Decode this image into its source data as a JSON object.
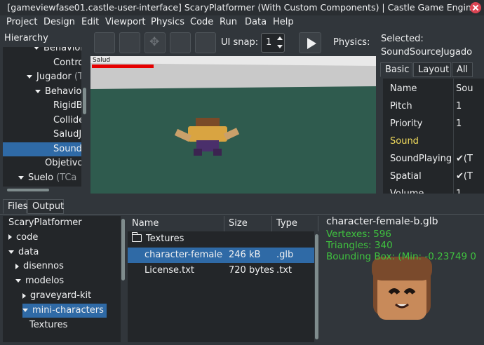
{
  "window": {
    "title": "[gameviewfase01.castle-user-interface] ScaryPlatformer (With Custom Components) | Castle Game Engine"
  },
  "menu": [
    "Project",
    "Design",
    "Edit",
    "Viewport",
    "Physics",
    "Code",
    "Run",
    "Data",
    "Help"
  ],
  "hierarchy": {
    "label": "Hierarchy",
    "items": [
      {
        "text": "Behavior",
        "suffix": "",
        "expanded": true
      },
      {
        "text": "Control",
        "suffix": "",
        "expanded": null
      },
      {
        "text": "Jugador",
        "suffix": "(T",
        "expanded": true
      },
      {
        "text": "Behavior",
        "suffix": "",
        "expanded": true
      },
      {
        "text": "RigidBc",
        "suffix": "",
        "expanded": null
      },
      {
        "text": "Collider",
        "suffix": "",
        "expanded": null
      },
      {
        "text": "SaludJu",
        "suffix": "",
        "expanded": null
      },
      {
        "text": "SoundS",
        "suffix": "",
        "expanded": null,
        "selected": true
      },
      {
        "text": "Objetivo",
        "suffix": "",
        "expanded": null
      },
      {
        "text": "Suelo",
        "suffix": "(TCa",
        "expanded": true
      }
    ]
  },
  "toolbar": {
    "ui_snap_label": "UI snap:",
    "ui_snap_value": "1",
    "physics_label": "Physics:"
  },
  "viewport": {
    "health_label": "Salud",
    "health_fraction": 0.7
  },
  "inspector": {
    "selected_label": "Selected:",
    "selected_name": "SoundSourceJugado",
    "tabs": [
      {
        "label": "Basic",
        "active": true
      },
      {
        "label": "Layout",
        "active": false
      },
      {
        "label": "All",
        "active": false
      }
    ],
    "rows": [
      {
        "name": "Name",
        "value": "Sou",
        "highlight": false
      },
      {
        "name": "Pitch",
        "value": "1",
        "highlight": false
      },
      {
        "name": "Priority",
        "value": "1",
        "highlight": false
      },
      {
        "name": "Sound",
        "value": "",
        "highlight": true
      },
      {
        "name": "SoundPlaying",
        "value": "✔(T",
        "highlight": false
      },
      {
        "name": "Spatial",
        "value": "✔(T",
        "highlight": false
      },
      {
        "name": "Volume",
        "value": "1",
        "highlight": false
      }
    ]
  },
  "bottom_tabs": [
    {
      "label": "Files",
      "active": true
    },
    {
      "label": "Output",
      "active": false
    }
  ],
  "files_tree": [
    {
      "text": "ScaryPlatformer",
      "arrow": "none",
      "level": 0
    },
    {
      "text": "code",
      "arrow": "right",
      "level": 0
    },
    {
      "text": "data",
      "arrow": "down",
      "level": 0
    },
    {
      "text": "disennos",
      "arrow": "right",
      "level": 1
    },
    {
      "text": "modelos",
      "arrow": "down",
      "level": 1
    },
    {
      "text": "graveyard-kit",
      "arrow": "right",
      "level": 2
    },
    {
      "text": "mini-characters",
      "arrow": "down",
      "level": 2,
      "selected": true
    },
    {
      "text": "Textures",
      "arrow": "none",
      "level": 3
    }
  ],
  "file_list": {
    "headers": [
      "Name",
      "Size",
      "Type"
    ],
    "rows": [
      {
        "name": "Textures",
        "size": "",
        "type": "",
        "folder": true
      },
      {
        "name": "character-female-b.glb",
        "size": "246 kB",
        "type": ".glb",
        "selected": true
      },
      {
        "name": "License.txt",
        "size": "720 bytes",
        "type": ".txt"
      }
    ]
  },
  "preview": {
    "filename": "character-female-b.glb",
    "vertexes": "Vertexes: 596",
    "triangles": "Triangles: 340",
    "bbox": "Bounding Box: (Min: -0.23749 0"
  },
  "colors": {
    "accent": "#2f6aa6",
    "info_green": "#3fc23f",
    "sound_yellow": "#f3dd5d",
    "health_red": "#e60000"
  }
}
